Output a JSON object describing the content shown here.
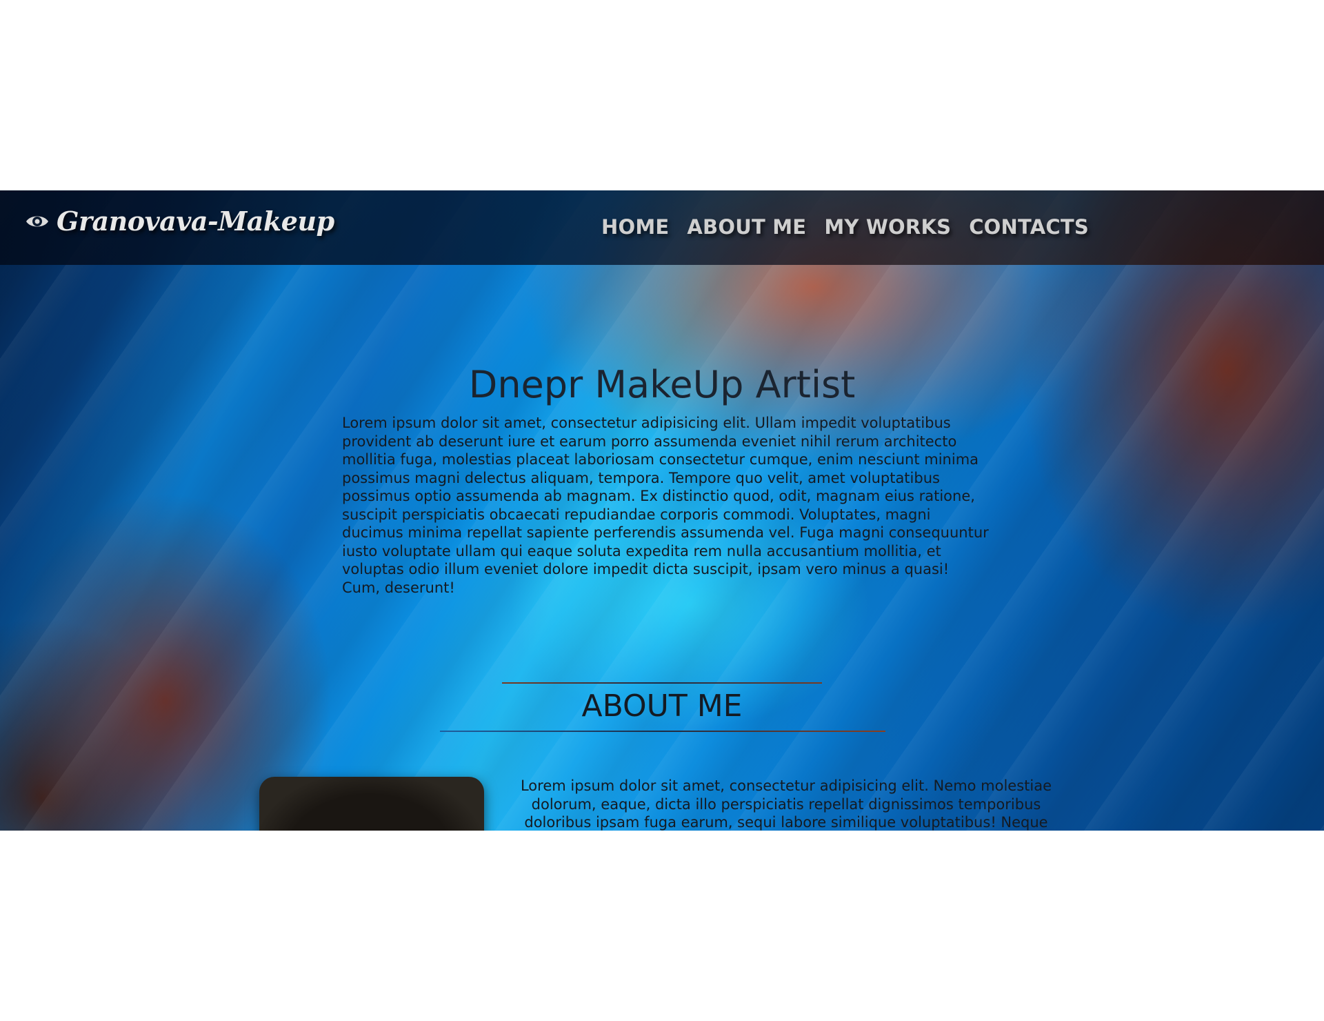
{
  "brand": {
    "name": "Granovava-Makeup",
    "icon": "eye-icon"
  },
  "nav": {
    "items": [
      {
        "label": "HOME"
      },
      {
        "label": "ABOUT ME"
      },
      {
        "label": "MY WORKS"
      },
      {
        "label": "CONTACTS"
      }
    ]
  },
  "hero": {
    "title": "Dnepr MakeUp Artist",
    "text": "Lorem ipsum dolor sit amet, consectetur adipisicing elit. Ullam impedit voluptatibus provident ab deserunt iure et earum porro assumenda eveniet nihil rerum architecto mollitia fuga, molestias placeat laboriosam consectetur cumque, enim nesciunt minima possimus magni delectus aliquam, tempora. Tempore quo velit, amet voluptatibus possimus optio assumenda ab magnam. Ex distinctio quod, odit, magnam eius ratione, suscipit perspiciatis obcaecati repudiandae corporis commodi. Voluptates, magni ducimus minima repellat sapiente perferendis assumenda vel. Fuga magni consequuntur iusto voluptate ullam qui eaque soluta expedita rem nulla accusantium mollitia, et voluptas odio illum eveniet dolore impedit dicta suscipit, ipsam vero minus a quasi! Cum, deserunt!"
  },
  "about": {
    "title": "ABOUT ME",
    "text": "Lorem ipsum dolor sit amet, consectetur adipisicing elit. Nemo molestiae dolorum, eaque, dicta illo perspiciatis repellat dignissimos temporibus doloribus ipsam fuga earum, sequi labore similique voluptatibus! Neque ipsa"
  },
  "colors": {
    "navbar_bg": "#03142d",
    "nav_text": "#cfcfcf",
    "heading_text": "#1b2430",
    "body_text": "#141a22",
    "page_bg": "#ffffff"
  }
}
